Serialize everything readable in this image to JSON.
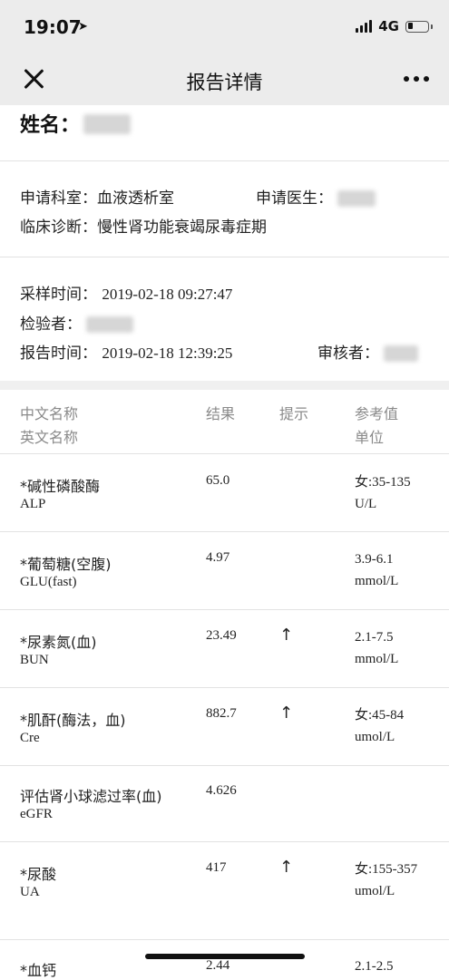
{
  "status": {
    "time": "19:07",
    "network": "4G"
  },
  "nav": {
    "title": "报告详情"
  },
  "patient": {
    "name_label": "姓名："
  },
  "request": {
    "dept_label": "申请科室：",
    "dept_value": "血液透析室",
    "doctor_label": "申请医生：",
    "diagnosis_label": "临床诊断：",
    "diagnosis_value": "慢性肾功能衰竭尿毒症期"
  },
  "timing": {
    "sample_label": "采样时间：",
    "sample_value": "2019-02-18 09:27:47",
    "inspector_label": "检验者：",
    "report_label": "报告时间：",
    "report_value": "2019-02-18 12:39:25",
    "reviewer_label": "审核者："
  },
  "table": {
    "headers": {
      "cn_name": "中文名称",
      "en_name": "英文名称",
      "result": "结果",
      "hint": "提示",
      "ref": "参考值",
      "unit": "单位"
    },
    "rows": [
      {
        "cn": "*碱性磷酸酶",
        "en": "ALP",
        "result": "65.0",
        "hint": "",
        "ref": "女:35-135",
        "unit": "U/L"
      },
      {
        "cn": "*葡萄糖(空腹)",
        "en": "GLU(fast)",
        "result": "4.97",
        "hint": "",
        "ref": "3.9-6.1",
        "unit": "mmol/L"
      },
      {
        "cn": "*尿素氮(血)",
        "en": "BUN",
        "result": "23.49",
        "hint": "↑",
        "ref": "2.1-7.5",
        "unit": "mmol/L"
      },
      {
        "cn": "*肌酐(酶法，血)",
        "en": "Cre",
        "result": "882.7",
        "hint": "↑",
        "ref": "女:45-84",
        "unit": "umol/L"
      },
      {
        "cn": "评估肾小球滤过率(血)",
        "en": "eGFR",
        "result": "4.626",
        "hint": "",
        "ref": "",
        "unit": ""
      },
      {
        "cn": "*尿酸",
        "en": "UA",
        "result": "417",
        "hint": "↑",
        "ref": "女:155-357",
        "unit": "umol/L"
      },
      {
        "cn": "*血钙",
        "en": "",
        "result": "2.44",
        "hint": "",
        "ref": "2.1-2.5",
        "unit": ""
      }
    ]
  }
}
